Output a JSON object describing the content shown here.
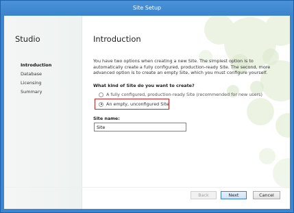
{
  "window": {
    "title": "Site Setup"
  },
  "sidebar": {
    "heading": "Studio",
    "items": [
      {
        "label": "Introduction",
        "active": true
      },
      {
        "label": "Database",
        "active": false
      },
      {
        "label": "Licensing",
        "active": false
      },
      {
        "label": "Summary",
        "active": false
      }
    ]
  },
  "main": {
    "heading": "Introduction",
    "intro": "You have two options when creating a new Site. The simplest option is to automatically create a fully configured, production-ready Site. The second, more advanced option is to create an empty Site, which you must configure yourself.",
    "question": "What kind of Site do you want to create?",
    "options": [
      {
        "label": "A fully configured, production-ready Site (recommended for new users)",
        "selected": false
      },
      {
        "label": "An empty, unconfigured Site",
        "selected": true
      }
    ],
    "site_name_label": "Site name:",
    "site_name_value": "Site"
  },
  "buttons": {
    "back": "Back",
    "next": "Next",
    "cancel": "Cancel"
  },
  "colors": {
    "titlebar": "#3b83cc",
    "highlight": "#c62828",
    "accent": "#4d8bd0"
  }
}
